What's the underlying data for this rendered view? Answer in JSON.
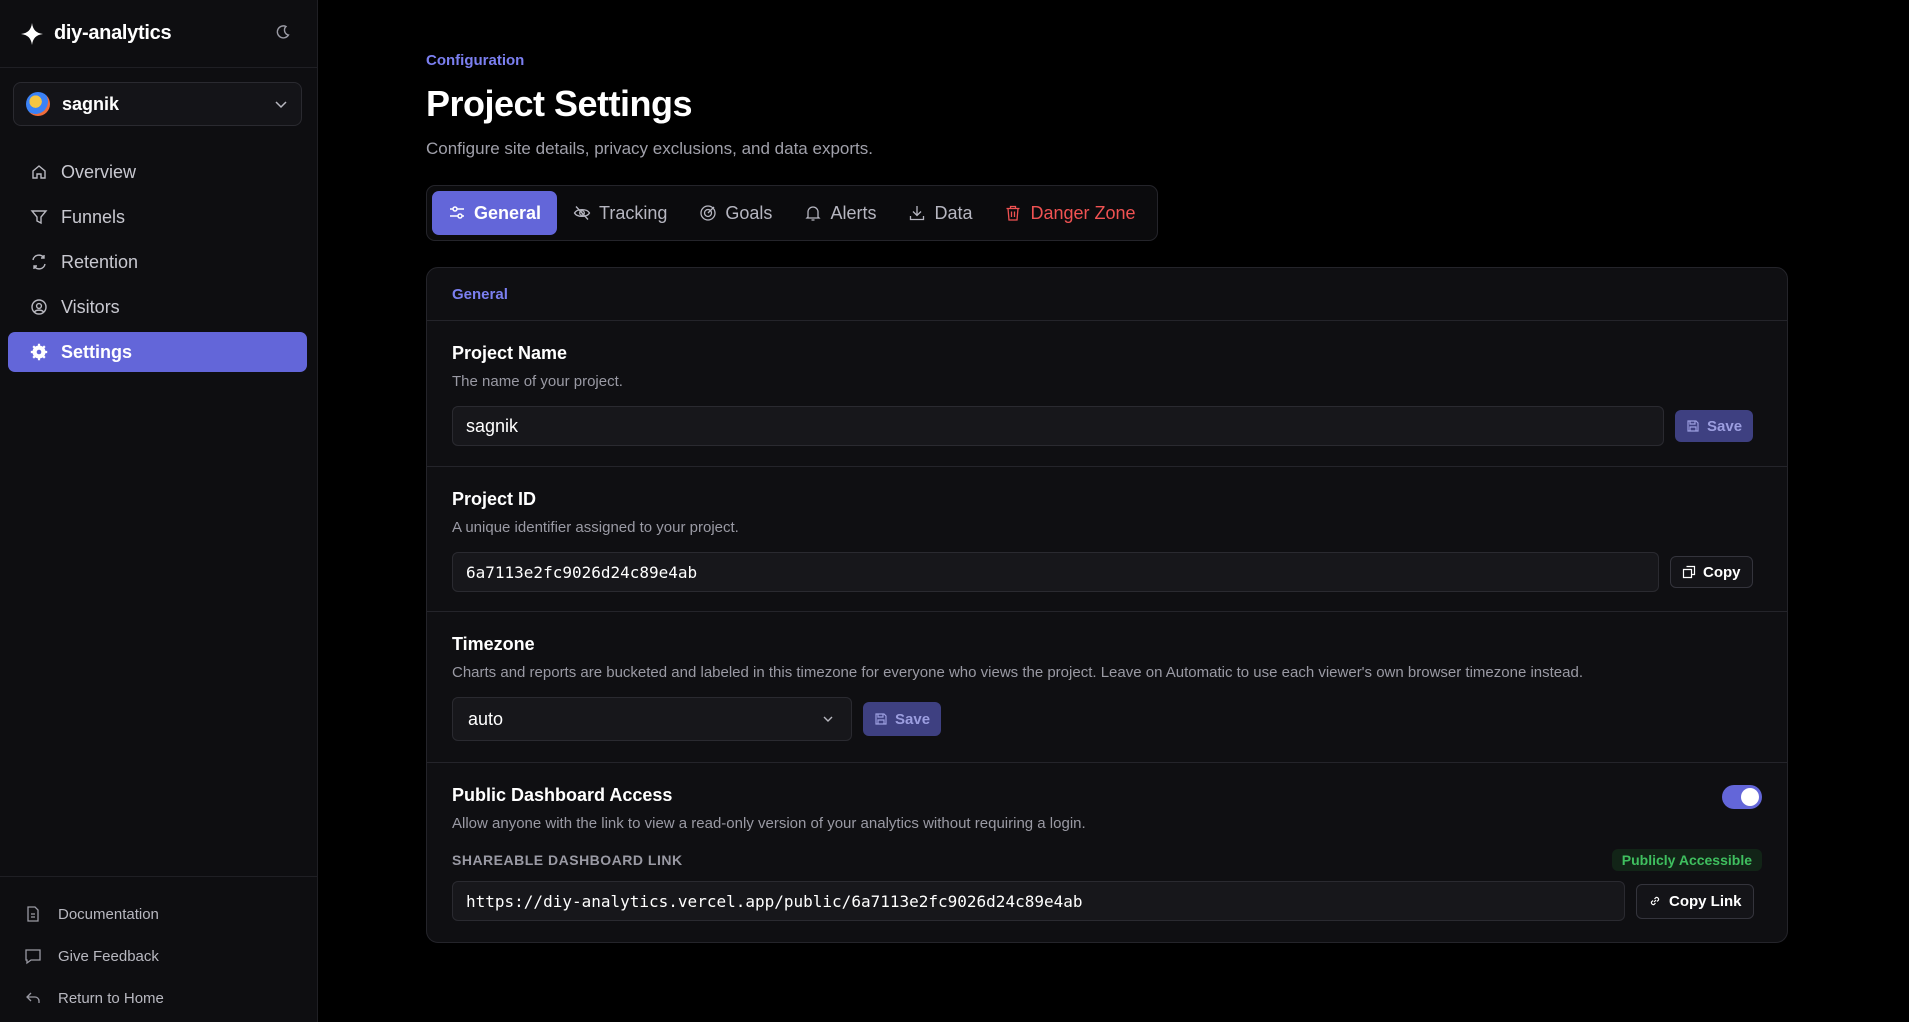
{
  "brand": {
    "name": "diy-analytics"
  },
  "project_selector": {
    "name": "sagnik"
  },
  "nav": {
    "items": [
      {
        "label": "Overview",
        "icon": "home-icon"
      },
      {
        "label": "Funnels",
        "icon": "funnel-icon"
      },
      {
        "label": "Retention",
        "icon": "refresh-icon"
      },
      {
        "label": "Visitors",
        "icon": "user-circle-icon"
      },
      {
        "label": "Settings",
        "icon": "gear-icon",
        "active": true
      }
    ]
  },
  "footer": {
    "items": [
      {
        "label": "Documentation",
        "icon": "document-icon"
      },
      {
        "label": "Give Feedback",
        "icon": "message-icon"
      },
      {
        "label": "Return to Home",
        "icon": "return-icon"
      }
    ]
  },
  "header": {
    "kicker": "Configuration",
    "title": "Project Settings",
    "subtitle": "Configure site details, privacy exclusions, and data exports."
  },
  "tabs": [
    {
      "label": "General",
      "icon": "sliders-icon",
      "active": true
    },
    {
      "label": "Tracking",
      "icon": "eye-off-icon"
    },
    {
      "label": "Goals",
      "icon": "target-icon"
    },
    {
      "label": "Alerts",
      "icon": "bell-icon"
    },
    {
      "label": "Data",
      "icon": "download-icon"
    },
    {
      "label": "Danger Zone",
      "icon": "trash-icon",
      "danger": true
    }
  ],
  "card": {
    "heading": "General",
    "project_name": {
      "title": "Project Name",
      "desc": "The name of your project.",
      "value": "sagnik",
      "save_label": "Save"
    },
    "project_id": {
      "title": "Project ID",
      "desc": "A unique identifier assigned to your project.",
      "value": "6a7113e2fc9026d24c89e4ab",
      "copy_label": "Copy"
    },
    "timezone": {
      "title": "Timezone",
      "desc": "Charts and reports are bucketed and labeled in this timezone for everyone who views the project. Leave on Automatic to use each viewer's own browser timezone instead.",
      "value": "auto",
      "save_label": "Save"
    },
    "public_access": {
      "title": "Public Dashboard Access",
      "desc": "Allow anyone with the link to view a read-only version of your analytics without requiring a login.",
      "enabled": true,
      "share_label": "SHAREABLE DASHBOARD LINK",
      "badge": "Publicly Accessible",
      "link": "https://diy-analytics.vercel.app/public/6a7113e2fc9026d24c89e4ab",
      "copy_label": "Copy Link"
    }
  },
  "colors": {
    "accent": "#6366d9",
    "danger": "#f05252",
    "success": "#3fbf5f",
    "background": "#000000",
    "sidebar": "#0e0e11"
  }
}
